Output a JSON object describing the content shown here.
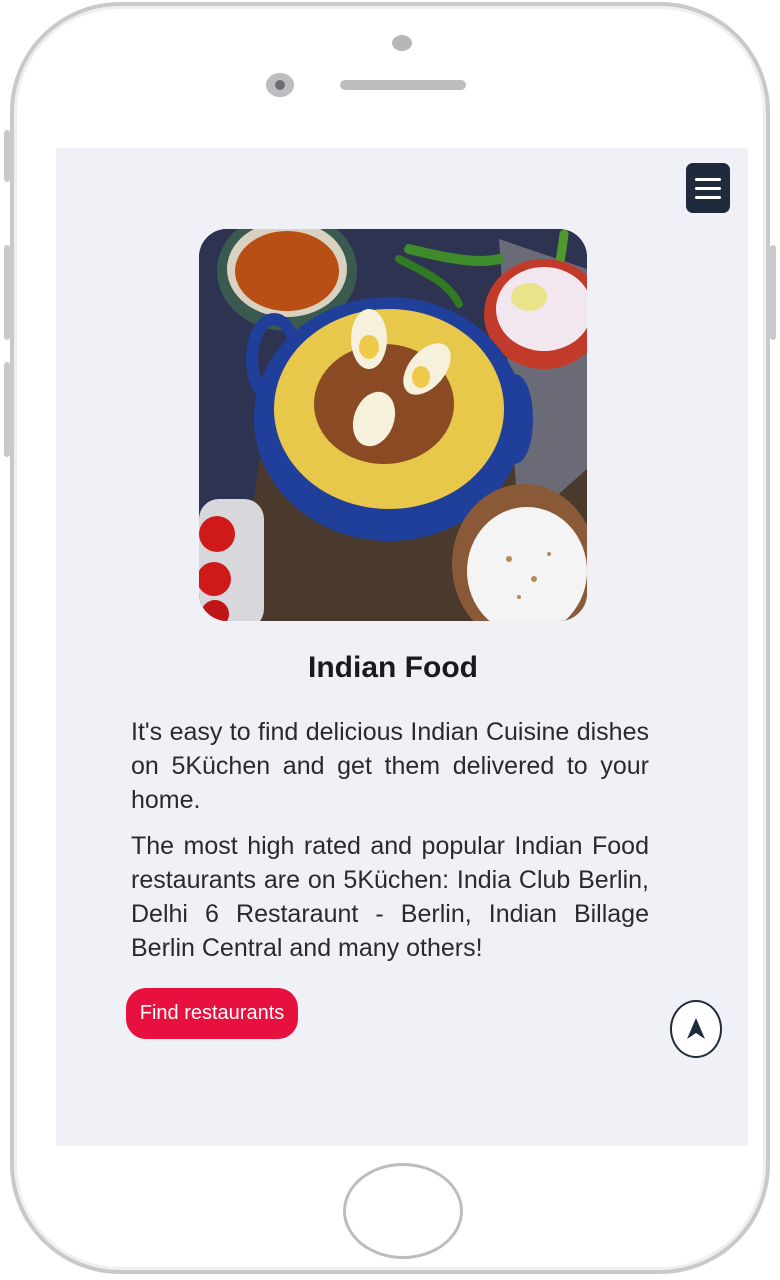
{
  "header": {
    "menu_icon": "hamburger-menu-icon"
  },
  "hero": {
    "image_alt": "Indian food dish with biryani, boiled eggs, raita, tomatoes and chilies"
  },
  "content": {
    "title": "Indian Food",
    "paragraph_1": "It's easy to find delicious Indian Cuisine dishes on 5Küchen and get them delivered to your home.",
    "paragraph_2": "The most high rated and popular Indian Food restaurants are on 5Küchen: India Club Berlin, Delhi 6 Restaraunt - Berlin, Indian Billage Berlin Central and many others!"
  },
  "actions": {
    "find_label": "Find restaurants",
    "nav_icon": "navigation-arrow-icon"
  },
  "colors": {
    "screen_bg": "#f0f1f6",
    "accent": "#e8103f",
    "menu_bg": "#1f2b3c"
  }
}
